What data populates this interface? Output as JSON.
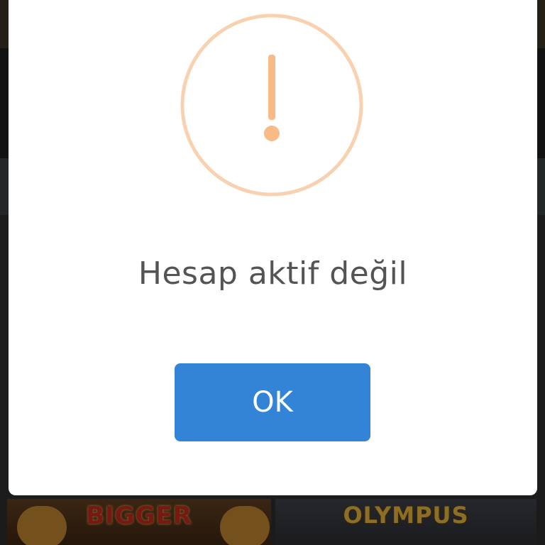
{
  "dialog": {
    "icon": "warning-exclamation-icon",
    "message": "Hesap aktif değil",
    "confirm_label": "OK"
  },
  "colors": {
    "accent_button": "#3384d6",
    "warning_icon": "#f8bb86",
    "message_text": "#545454"
  },
  "background": {
    "tiles": [
      {
        "title": "BIGGER"
      },
      {
        "title": "OLYMPUS"
      }
    ]
  }
}
